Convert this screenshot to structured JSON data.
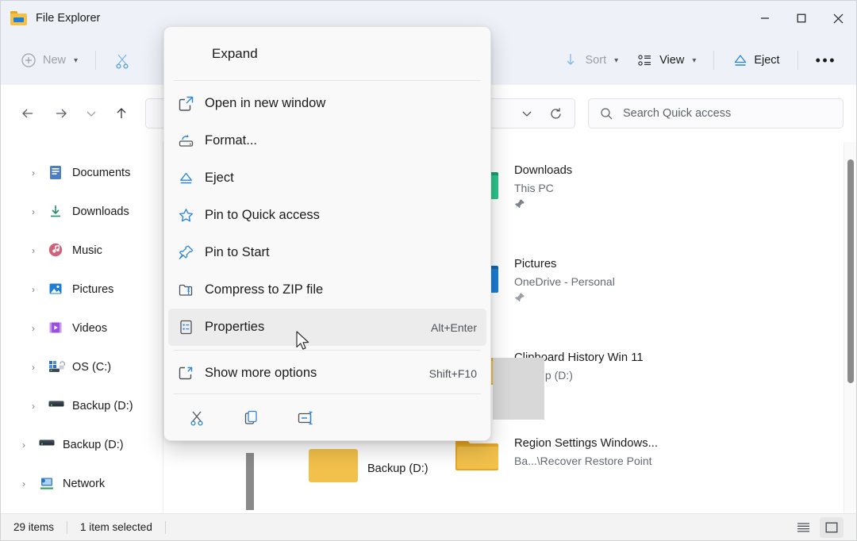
{
  "window": {
    "title": "File Explorer",
    "icon": "folder-drive-icon",
    "controls": {
      "minimize": "Minimize",
      "maximize": "Maximize",
      "close": "Close"
    }
  },
  "toolbar": {
    "new_label": "New",
    "new_icon": "plus-circle-icon",
    "cut_icon": "scissors-icon",
    "sort_label": "Sort",
    "sort_icon": "sort-arrow-icon",
    "view_label": "View",
    "view_icon": "view-list-icon",
    "eject_label": "Eject",
    "eject_icon": "eject-icon",
    "more_label": "See more",
    "more_icon": "ellipsis-icon"
  },
  "nav": {
    "back": "Back",
    "forward": "Forward",
    "recent": "Recent locations",
    "up": "Up to This PC",
    "address_dropdown_icon": "chevron-down-icon",
    "refresh_icon": "refresh-icon"
  },
  "search": {
    "placeholder": "Search Quick access",
    "icon": "search-icon",
    "value": ""
  },
  "sidebar": {
    "items": [
      {
        "label": "Documents",
        "icon": "documents-icon",
        "indent": 1,
        "caret": "›"
      },
      {
        "label": "Downloads",
        "icon": "downloads-icon",
        "indent": 1,
        "caret": "›"
      },
      {
        "label": "Music",
        "icon": "music-icon",
        "indent": 1,
        "caret": "›"
      },
      {
        "label": "Pictures",
        "icon": "pictures-icon",
        "indent": 1,
        "caret": "›"
      },
      {
        "label": "Videos",
        "icon": "videos-icon",
        "indent": 1,
        "caret": "›"
      },
      {
        "label": "OS (C:)",
        "icon": "os-drive-icon",
        "indent": 1,
        "caret": "›"
      },
      {
        "label": "Backup (D:)",
        "icon": "drive-icon",
        "indent": 1,
        "caret": "›"
      },
      {
        "label": "Backup (D:)",
        "icon": "drive-icon",
        "indent": 0,
        "caret": "›"
      },
      {
        "label": "Network",
        "icon": "network-icon",
        "indent": 0,
        "caret": "›"
      }
    ]
  },
  "files": {
    "items": [
      {
        "name": "Downloads",
        "sub": "This PC",
        "thumb": "downloads-folder",
        "pinned": true,
        "cloud": false
      },
      {
        "name": "Pictures",
        "sub": "OneDrive - Personal",
        "thumb": "pictures-folder",
        "pinned": true,
        "cloud": true
      },
      {
        "name": "Clipboard History Win 11",
        "sub": "Backup (D:)",
        "thumb": "yellow-folder",
        "pinned": false,
        "cloud": false
      },
      {
        "name": "Region Settings Windows...",
        "sub": "Ba...\\Recover Restore Point",
        "thumb": "yellow-folder",
        "pinned": false,
        "cloud": false
      }
    ],
    "partial_label": "Backup (D:)"
  },
  "context_menu": {
    "header": {
      "label": "Expand",
      "icon": ""
    },
    "items": [
      {
        "label": "Open in new window",
        "icon": "open-new-window-icon",
        "shortcut": "",
        "highlighted": false
      },
      {
        "label": "Format...",
        "icon": "format-disk-icon",
        "shortcut": "",
        "highlighted": false
      },
      {
        "label": "Eject",
        "icon": "eject-icon",
        "shortcut": "",
        "highlighted": false
      },
      {
        "label": "Pin to Quick access",
        "icon": "star-icon",
        "shortcut": "",
        "highlighted": false
      },
      {
        "label": "Pin to Start",
        "icon": "pin-icon",
        "shortcut": "",
        "highlighted": false
      },
      {
        "label": "Compress to ZIP file",
        "icon": "zip-folder-icon",
        "shortcut": "",
        "highlighted": false
      },
      {
        "label": "Properties",
        "icon": "properties-icon",
        "shortcut": "Alt+Enter",
        "highlighted": true
      }
    ],
    "after_divider": [
      {
        "label": "Show more options",
        "icon": "show-more-options-icon",
        "shortcut": "Shift+F10",
        "highlighted": false
      }
    ],
    "icon_row": [
      {
        "name": "cut-icon",
        "label": "Cut"
      },
      {
        "name": "copy-icon",
        "label": "Copy"
      },
      {
        "name": "rename-icon",
        "label": "Rename"
      }
    ]
  },
  "status": {
    "item_count": "29 items",
    "selection": "1 item selected",
    "details_view_icon": "details-view-icon",
    "large_icons_view_icon": "large-icons-view-icon"
  },
  "colors": {
    "accent": "#2f86d9",
    "titlebar_bg": "#eef2f8",
    "menu_bg": "#f9f9f9",
    "highlight": "#ececec",
    "folder_yellow": "#f2c14b",
    "downloads_green": "#179c6d",
    "text": "#1b1b1b",
    "subtext": "#636a72"
  }
}
